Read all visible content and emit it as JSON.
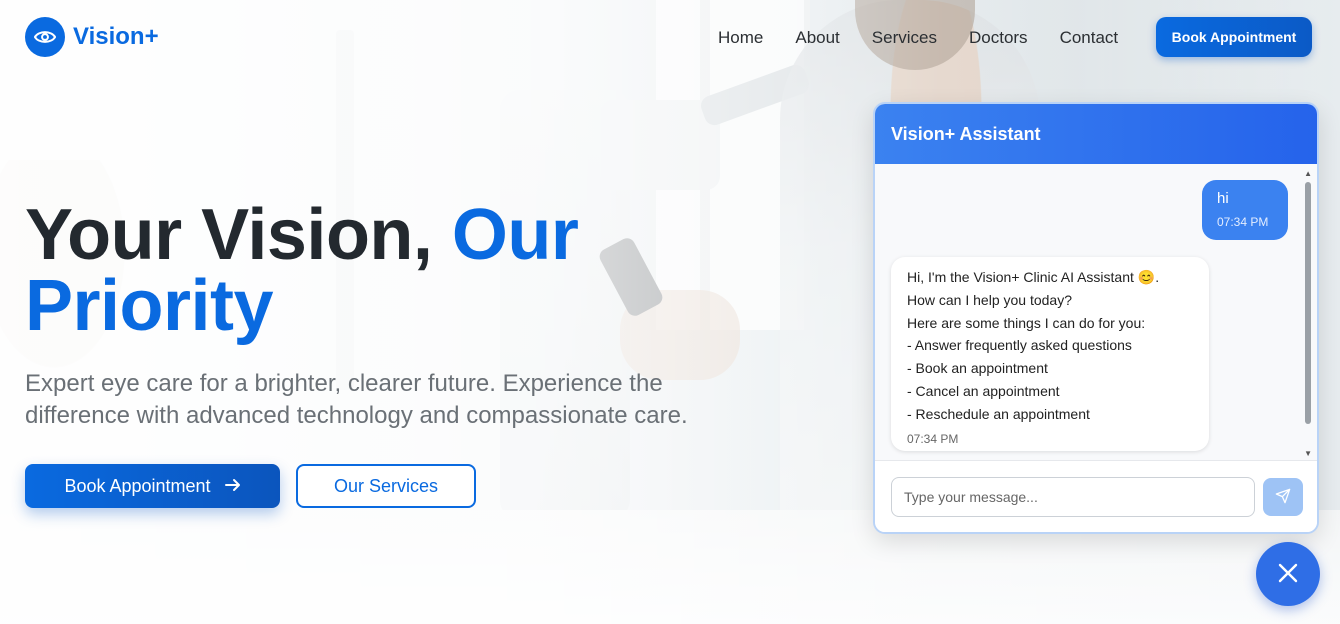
{
  "brand": {
    "name": "Vision+",
    "icon": "eye-icon",
    "color": "#0a6ae0"
  },
  "nav": {
    "items": [
      "Home",
      "About",
      "Services",
      "Doctors",
      "Contact"
    ],
    "cta": "Book Appointment"
  },
  "hero": {
    "title_part1": "Your Vision,",
    "title_accent1": "Our",
    "title_accent2": "Priority",
    "subtitle": "Expert eye care for a brighter, clearer future. Experience the difference with advanced technology and compassionate care.",
    "primary_button": "Book Appointment",
    "primary_icon": "arrow-right-icon",
    "secondary_button": "Our Services"
  },
  "chat": {
    "title": "Vision+ Assistant",
    "messages": [
      {
        "from": "user",
        "text": "hi",
        "time": "07:34 PM"
      },
      {
        "from": "bot",
        "lines": [
          "Hi, I'm the Vision+ Clinic AI Assistant 😊.",
          "How can I help you today?",
          "Here are some things I can do for you:",
          "- Answer frequently asked questions",
          "- Book an appointment",
          "- Cancel an appointment",
          "- Reschedule an appointment"
        ],
        "time": "07:34 PM"
      }
    ],
    "input_placeholder": "Type your message...",
    "send_icon": "send-icon",
    "close_icon": "close-icon"
  }
}
